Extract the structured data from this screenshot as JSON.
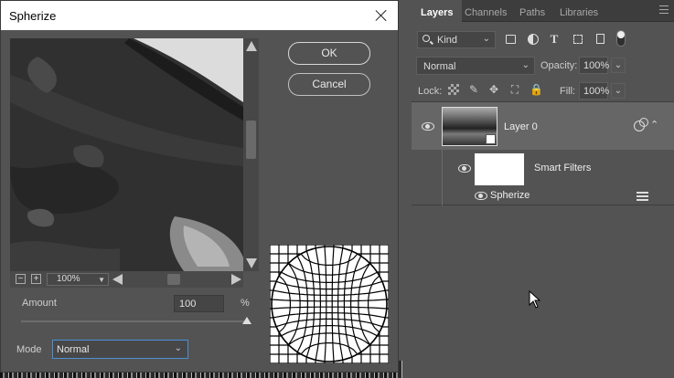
{
  "dialog": {
    "title": "Spherize",
    "ok_label": "OK",
    "cancel_label": "Cancel",
    "zoom_value": "100%",
    "amount_label": "Amount",
    "amount_value": "100",
    "amount_unit": "%",
    "amount_level_percent": 100,
    "mode_label": "Mode",
    "mode_value": "Normal"
  },
  "panel": {
    "tabs": [
      {
        "label": "Layers",
        "active": true
      },
      {
        "label": "Channels",
        "active": false
      },
      {
        "label": "Paths",
        "active": false
      },
      {
        "label": "Libraries",
        "active": false
      }
    ],
    "filter_kind": "Kind",
    "filter_icons": [
      "pixel-layer-filter-icon",
      "adjustment-layer-filter-icon",
      "type-layer-filter-icon",
      "shape-layer-filter-icon",
      "smart-object-filter-icon"
    ],
    "blend_mode": "Normal",
    "opacity_label": "Opacity:",
    "opacity_value": "100%",
    "lock_label": "Lock:",
    "fill_label": "Fill:",
    "fill_value": "100%",
    "layers": [
      {
        "name": "Layer 0",
        "smart_filters_label": "Smart Filters",
        "filters": [
          "Spherize"
        ]
      }
    ]
  },
  "colors": {
    "dialog_bg": "#535353",
    "panel_bg": "#535353",
    "selected_layer_bg": "#666666",
    "focus_accent": "#4a90d9"
  }
}
